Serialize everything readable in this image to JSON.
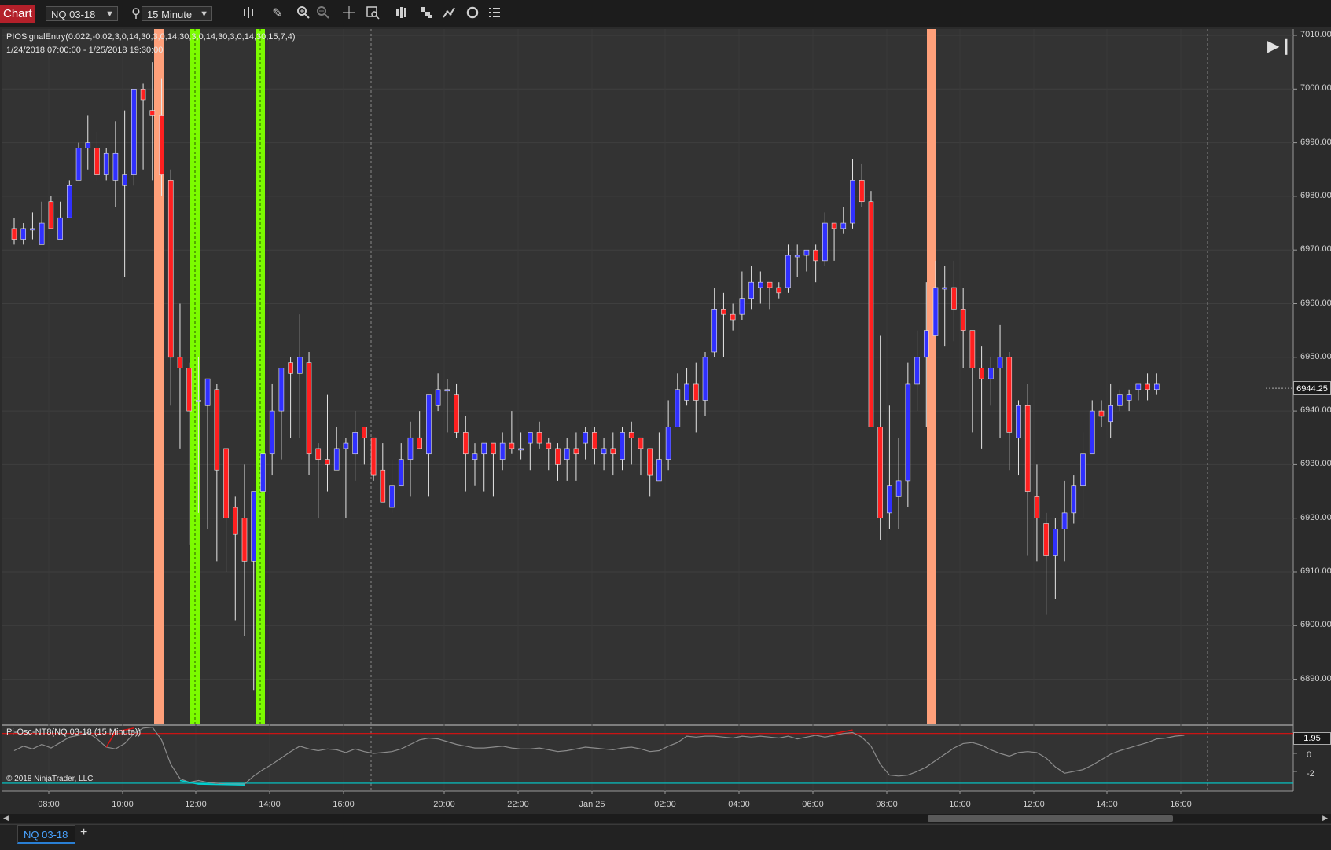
{
  "toolbar": {
    "chart_tab_label": "Chart",
    "instrument": "NQ 03-18",
    "interval": "15 Minute",
    "icons": [
      "search-icon",
      "bar-type-icon",
      "pencil-icon",
      "zoom-in-icon",
      "zoom-out-icon",
      "crosshair-icon",
      "data-box-icon",
      "chart-style-icon",
      "templates-icon",
      "strategies-icon",
      "reload-icon",
      "properties-icon"
    ]
  },
  "chart": {
    "indicator_title": "PIOSignalEntry(0.022,-0.02,3,0,14,30,3,0,14,30,3,0,14,30,3,0,14,30,15,7,4)",
    "date_range": "1/24/2018 07:00:00 - 1/25/2018 19:30:00",
    "current_price": "6944.25",
    "y_labels": [
      "7010.00",
      "7000.00",
      "6990.00",
      "6980.00",
      "6970.00",
      "6960.00",
      "6950.00",
      "6940.00",
      "6930.00",
      "6920.00",
      "6910.00",
      "6900.00",
      "6890.00"
    ],
    "x_labels": [
      "08:00",
      "10:00",
      "12:00",
      "14:00",
      "16:00",
      "20:00",
      "22:00",
      "Jan 25",
      "02:00",
      "04:00",
      "06:00",
      "08:00",
      "10:00",
      "12:00",
      "14:00",
      "16:00"
    ],
    "colors": {
      "up": "#3030ff",
      "down": "#ff2020",
      "sell_band": "#ffa07a",
      "buy_band": "#7cfc00",
      "background": "#333333"
    }
  },
  "oscillator": {
    "title": "Pi-Osc-NT8(NQ 03-18 (15 Minute))",
    "current_value": "1.95",
    "y_labels": [
      "0",
      "-2"
    ],
    "colors": {
      "line": "#8c8c8c",
      "upper": "#e01010",
      "lower": "#00d0d0"
    }
  },
  "footer": {
    "copyright": "© 2018 NinjaTrader, LLC",
    "instrument_tab": "NQ 03-18",
    "add_tab": "+"
  }
}
